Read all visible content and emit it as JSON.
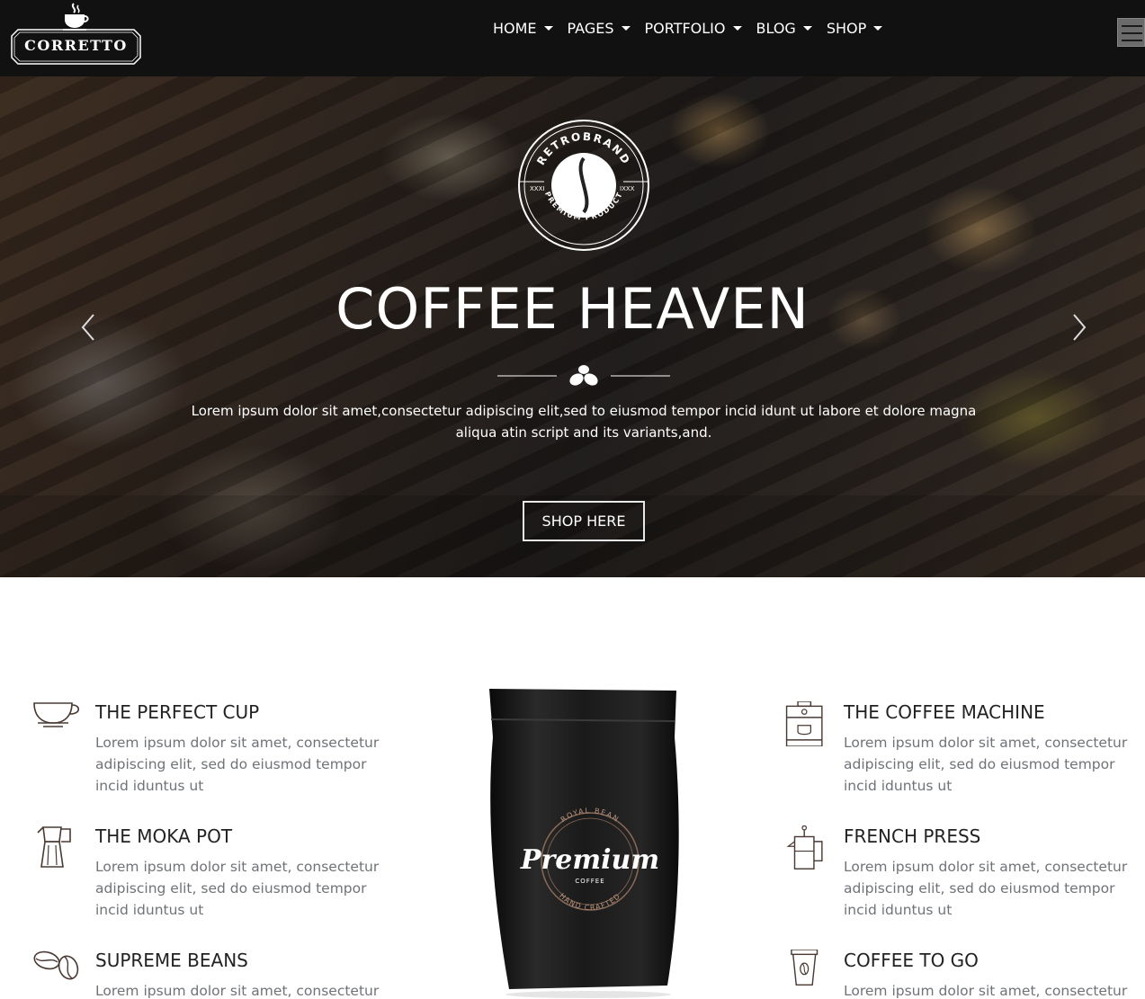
{
  "brand": {
    "name": "CORRETTO"
  },
  "nav": {
    "items": [
      {
        "label": "HOME"
      },
      {
        "label": "PAGES"
      },
      {
        "label": "PORTFOLIO"
      },
      {
        "label": "BLOG"
      },
      {
        "label": "SHOP"
      }
    ]
  },
  "hero": {
    "badge": {
      "top_text": "RETROBRAND",
      "bottom_text": "PREMIUM PRODUCT",
      "left_mark": "XXXI",
      "right_mark": "IXXX"
    },
    "title": "COFFEE HEAVEN",
    "text": "Lorem ipsum dolor sit amet,consectetur adipiscing elit,sed to eiusmod tempor incid idunt ut labore et dolore magna aliqua atin script and its variants,and.",
    "button_label": "SHOP HERE"
  },
  "features": {
    "left": [
      {
        "title": "THE PERFECT CUP",
        "desc": "Lorem ipsum dolor sit amet, consectetur adipiscing elit, sed do eiusmod tempor incid iduntus ut",
        "icon": "coffee-cup-icon"
      },
      {
        "title": "THE MOKA POT",
        "desc": "Lorem ipsum dolor sit amet, consectetur adipiscing elit, sed do eiusmod tempor incid iduntus ut",
        "icon": "moka-pot-icon"
      },
      {
        "title": "SUPREME BEANS",
        "desc": "Lorem ipsum dolor sit amet, consectetur",
        "icon": "coffee-beans-icon"
      }
    ],
    "right": [
      {
        "title": "THE COFFEE MACHINE",
        "desc": "Lorem ipsum dolor sit amet, consectetur adipiscing elit, sed do eiusmod tempor incid iduntus ut",
        "icon": "coffee-machine-icon"
      },
      {
        "title": "FRENCH PRESS",
        "desc": "Lorem ipsum dolor sit amet, consectetur adipiscing elit, sed do eiusmod tempor incid iduntus ut",
        "icon": "french-press-icon"
      },
      {
        "title": "COFFEE TO GO",
        "desc": "Lorem ipsum dolor sit amet, consectetur",
        "icon": "to-go-cup-icon"
      }
    ]
  },
  "product": {
    "arc_top": "ROYAL  BEAN",
    "script": "Premium",
    "sub": "COFFEE",
    "arc_bottom": "HAND CRAFTED"
  },
  "colors": {
    "header_bg": "#111111",
    "icon": "#4a3a33",
    "desc_text": "#6f7378"
  }
}
